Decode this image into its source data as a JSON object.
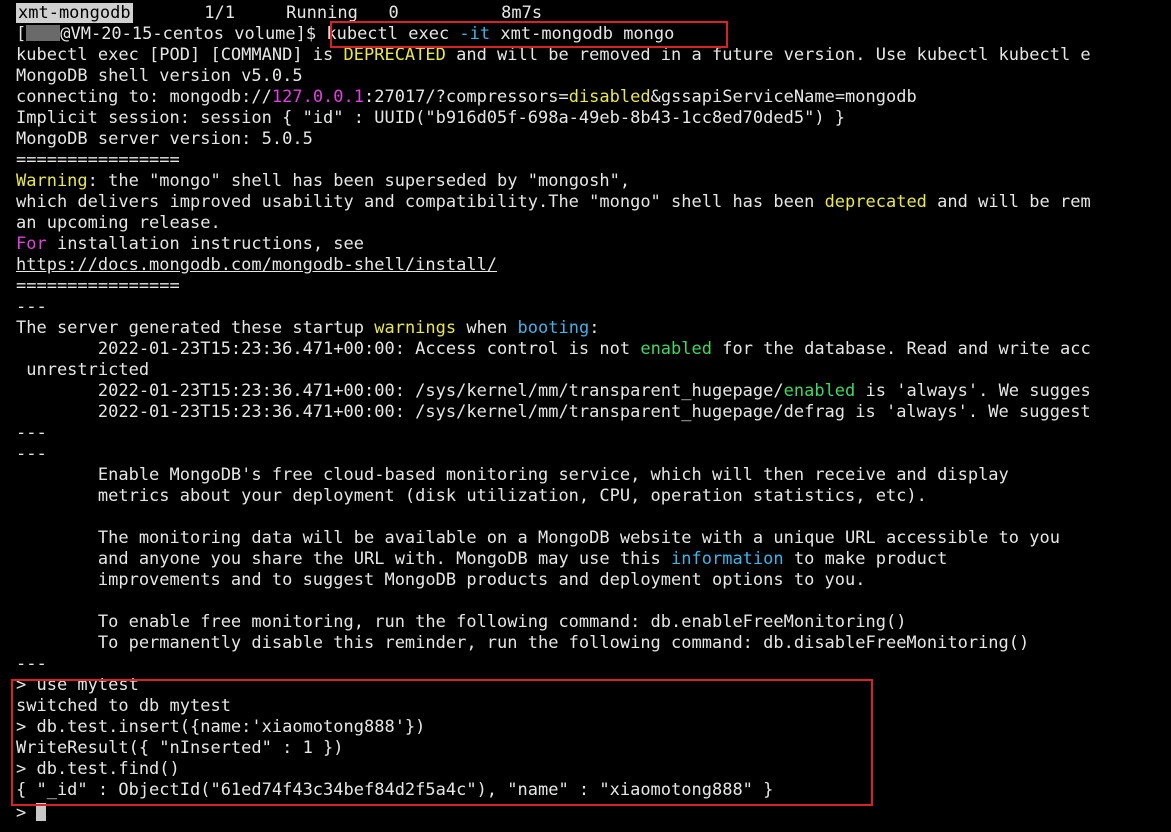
{
  "terminal": {
    "pod_status": {
      "name": "xmt-mongodb",
      "ready": "1/1",
      "status": "Running",
      "restarts": "0",
      "age": "8m7s"
    },
    "prompt": {
      "user_host": "@VM-20-15-centos volume]$ ",
      "cmd_a": "kubectl exec ",
      "cmd_flag": "-it",
      "cmd_b": " xmt-mongodb mongo"
    },
    "deprecation": {
      "a": "kubectl exec [POD] [COMMAND] is ",
      "word": "DEPRECATED",
      "b": " and will be removed in a future version. Use kubectl kubectl e"
    },
    "shell_version": "MongoDB shell version v5.0.5",
    "connect": {
      "a": "connecting to: mongodb://",
      "ip": "127.0.0.1",
      "b": ":27017/?compressors=",
      "disabled": "disabled",
      "c": "&gssapiServiceName=mongodb"
    },
    "session": "Implicit session: session { \"id\" : UUID(\"b916d05f-698a-49eb-8b43-1cc8ed70ded5\") }",
    "server_version": "MongoDB server version: 5.0.5",
    "separator": "================",
    "warning": {
      "label": "Warning",
      "text": ": the \"mongo\" shell has been superseded by \"mongosh\","
    },
    "delivers": {
      "a": "which delivers improved usability and compatibility.The \"mongo\" shell has been ",
      "deprecated": "deprecated",
      "b": " and will be rem"
    },
    "upcoming": "an upcoming release.",
    "install": {
      "for": "For",
      "text": " installation instructions, see"
    },
    "install_url": "https://docs.mongodb.com/mongodb-shell/install/",
    "dashes": "---",
    "startup": {
      "a": "The server generated these startup ",
      "warnings": "warnings",
      "b": " when ",
      "booting": "booting",
      "c": ":"
    },
    "access": {
      "a": "        2022-01-23T15:23:36.471+00:00: Access control is not ",
      "enabled": "enabled",
      "b": " for the database. Read and write acc"
    },
    "unrestricted": " unrestricted",
    "hugepage1": {
      "a": "        2022-01-23T15:23:36.471+00:00: /sys/kernel/mm/transparent_hugepage/",
      "enabled": "enabled",
      "b": " is 'always'. We sugges"
    },
    "hugepage2": "        2022-01-23T15:23:36.471+00:00: /sys/kernel/mm/transparent_hugepage/defrag is 'always'. We suggest",
    "monitoring": {
      "l1": "        Enable MongoDB's free cloud-based monitoring service, which will then receive and display",
      "l2": "        metrics about your deployment (disk utilization, CPU, operation statistics, etc).",
      "l3": "        The monitoring data will be available on a MongoDB website with a unique URL accessible to you",
      "l4a": "        and anyone you share the URL with. MongoDB may use this ",
      "information": "information",
      "l4b": " to make product",
      "l5": "        improvements and to suggest MongoDB products and deployment options to you.",
      "l6": "        To enable free monitoring, run the following command: db.enableFreeMonitoring()",
      "l7": "        To permanently disable this reminder, run the following command: db.disableFreeMonitoring()"
    },
    "session_cmds": {
      "use": "> use mytest",
      "switched": "switched to db mytest",
      "insert": "> db.test.insert({name:'xiaomotong888'})",
      "write_result": "WriteResult({ \"nInserted\" : 1 })",
      "find": "> db.test.find()",
      "find_result": "{ \"_id\" : ObjectId(\"61ed74f43c34bef84d2f5a4c\"), \"name\" : \"xiaomotong888\" }",
      "prompt": "> "
    }
  },
  "colors": {
    "background": "#000000",
    "foreground": "#e6e6e6",
    "yellow": "#e8e84a",
    "magenta": "#e040e0",
    "green": "#40d860",
    "cyan": "#3fb3e8",
    "highlight_border": "#d8222a"
  }
}
